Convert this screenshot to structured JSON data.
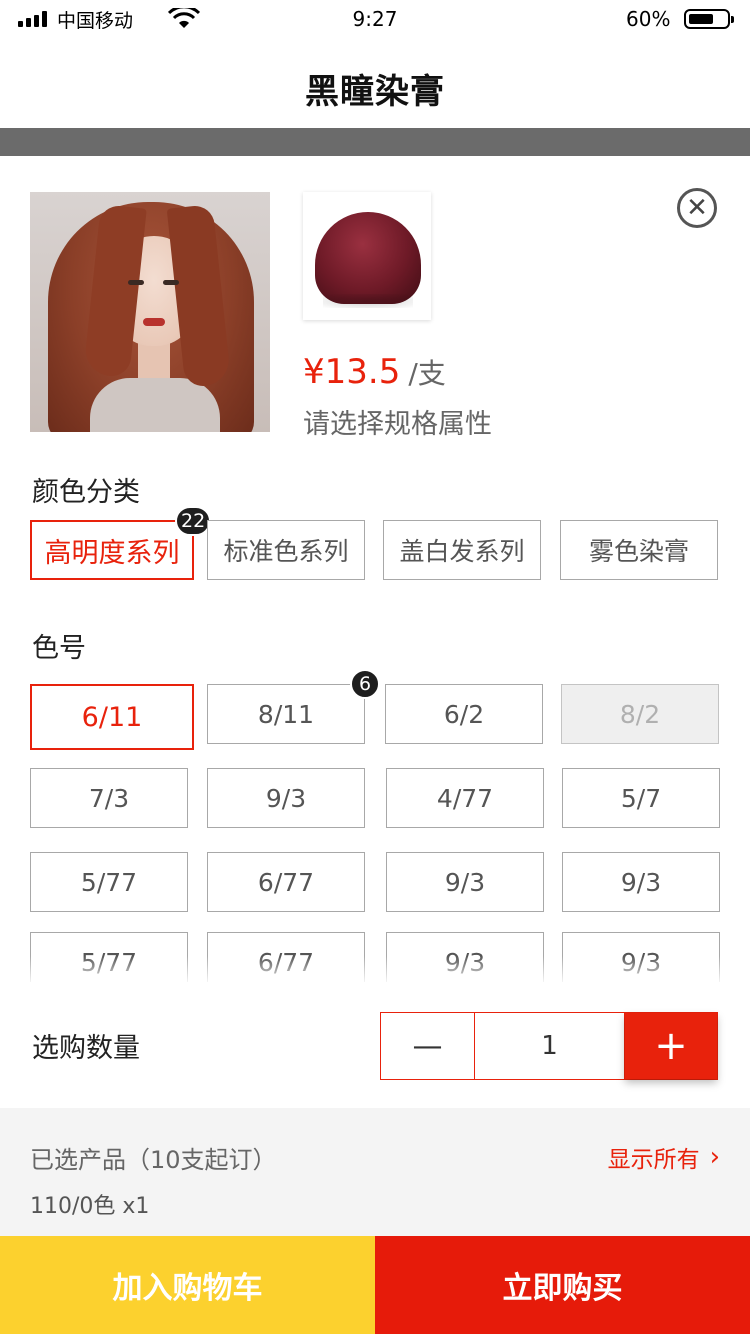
{
  "status_bar": {
    "carrier": "中国移动",
    "time": "9:27",
    "battery": "60%"
  },
  "nav": {
    "title": "黑瞳染膏"
  },
  "product": {
    "price": "¥13.5",
    "unit": "/支",
    "hint": "请选择规格属性",
    "close_icon": "close-icon"
  },
  "color_category": {
    "label": "颜色分类",
    "options": [
      {
        "label": "高明度系列",
        "state": "selected",
        "badge": "22"
      },
      {
        "label": "标准色系列",
        "state": "normal"
      },
      {
        "label": "盖白发系列",
        "state": "normal"
      },
      {
        "label": "雾色染膏",
        "state": "normal"
      }
    ]
  },
  "shade": {
    "label": "色号",
    "options": [
      {
        "label": "6/11",
        "state": "selected"
      },
      {
        "label": "8/11",
        "state": "normal",
        "badge": "6"
      },
      {
        "label": "6/2",
        "state": "normal"
      },
      {
        "label": "8/2",
        "state": "disabled"
      },
      {
        "label": "7/3",
        "state": "normal"
      },
      {
        "label": "9/3",
        "state": "normal"
      },
      {
        "label": "4/77",
        "state": "normal"
      },
      {
        "label": "5/7",
        "state": "normal"
      },
      {
        "label": "5/77",
        "state": "normal"
      },
      {
        "label": "6/77",
        "state": "normal"
      },
      {
        "label": "9/3",
        "state": "normal"
      },
      {
        "label": "9/3",
        "state": "normal"
      },
      {
        "label": "5/77",
        "state": "normal"
      },
      {
        "label": "6/77",
        "state": "normal"
      },
      {
        "label": "9/3",
        "state": "normal"
      },
      {
        "label": "9/3",
        "state": "normal"
      }
    ]
  },
  "quantity": {
    "label": "选购数量",
    "minus": "—",
    "value": "1",
    "plus": "+"
  },
  "selected": {
    "title": "已选产品（10支起订）",
    "show_all": "显示所有",
    "chevron": "›",
    "item": "110/0色 x1"
  },
  "actions": {
    "add_to_cart": "加入购物车",
    "buy_now": "立即购买"
  },
  "colors": {
    "accent": "#e8220c",
    "cart": "#fcd12e",
    "buy": "#e61b0a"
  }
}
